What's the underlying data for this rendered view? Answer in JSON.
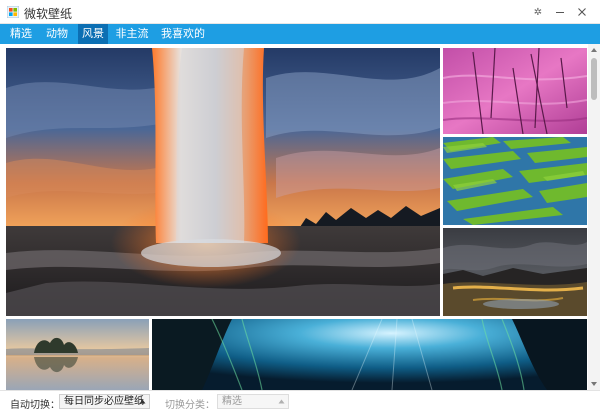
{
  "window": {
    "title": "微软壁纸",
    "skin_glyph": "✲",
    "min_icon": "minimize-icon",
    "close_icon": "close-icon"
  },
  "nav": {
    "tabs": [
      {
        "label": "精选"
      },
      {
        "label": "动物"
      },
      {
        "label": "风景",
        "active": true
      },
      {
        "label": "非主流"
      },
      {
        "label": "我喜欢的"
      }
    ]
  },
  "colors": {
    "accent": "#1e9ee3",
    "accent_active": "#0c6fb3"
  },
  "status": {
    "auto_switch_label": "自动切换：",
    "auto_switch_value": "每日同步必应壁纸",
    "category_label": "切换分类：",
    "category_value": "精选"
  }
}
